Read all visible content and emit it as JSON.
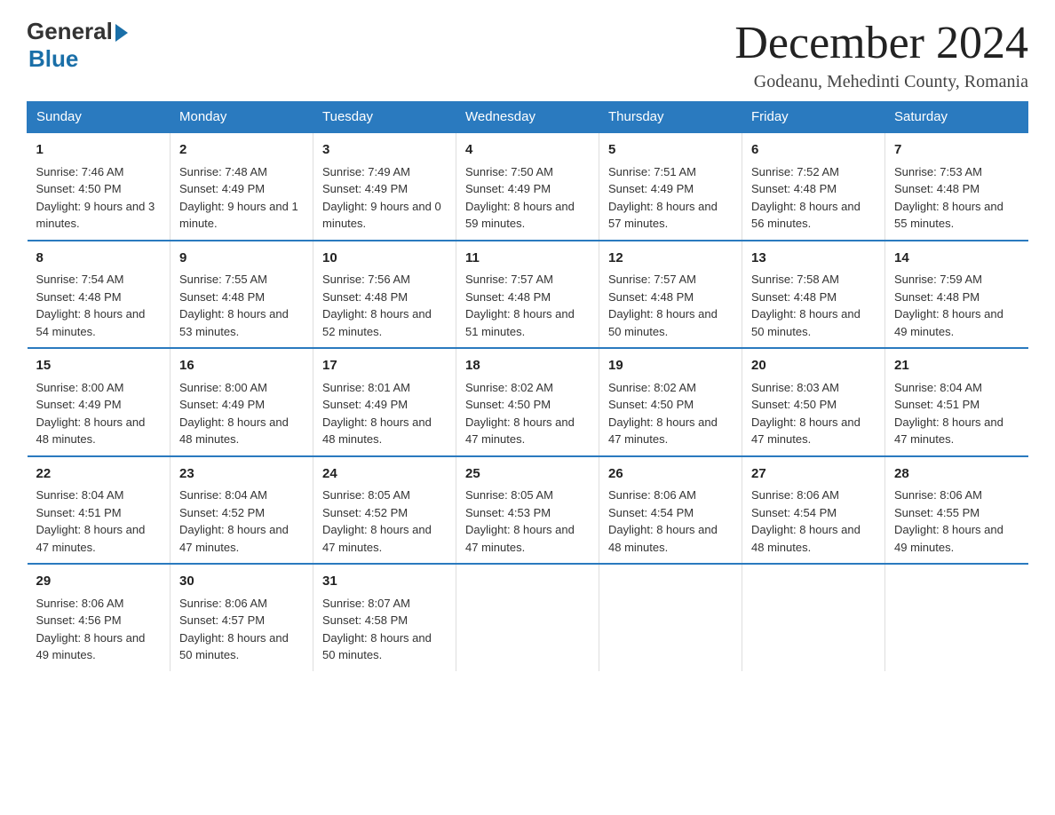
{
  "header": {
    "logo_general": "General",
    "logo_blue": "Blue",
    "month_title": "December 2024",
    "location": "Godeanu, Mehedinti County, Romania"
  },
  "days_of_week": [
    "Sunday",
    "Monday",
    "Tuesday",
    "Wednesday",
    "Thursday",
    "Friday",
    "Saturday"
  ],
  "weeks": [
    [
      {
        "day": "1",
        "sunrise": "7:46 AM",
        "sunset": "4:50 PM",
        "daylight": "9 hours and 3 minutes."
      },
      {
        "day": "2",
        "sunrise": "7:48 AM",
        "sunset": "4:49 PM",
        "daylight": "9 hours and 1 minute."
      },
      {
        "day": "3",
        "sunrise": "7:49 AM",
        "sunset": "4:49 PM",
        "daylight": "9 hours and 0 minutes."
      },
      {
        "day": "4",
        "sunrise": "7:50 AM",
        "sunset": "4:49 PM",
        "daylight": "8 hours and 59 minutes."
      },
      {
        "day": "5",
        "sunrise": "7:51 AM",
        "sunset": "4:49 PM",
        "daylight": "8 hours and 57 minutes."
      },
      {
        "day": "6",
        "sunrise": "7:52 AM",
        "sunset": "4:48 PM",
        "daylight": "8 hours and 56 minutes."
      },
      {
        "day": "7",
        "sunrise": "7:53 AM",
        "sunset": "4:48 PM",
        "daylight": "8 hours and 55 minutes."
      }
    ],
    [
      {
        "day": "8",
        "sunrise": "7:54 AM",
        "sunset": "4:48 PM",
        "daylight": "8 hours and 54 minutes."
      },
      {
        "day": "9",
        "sunrise": "7:55 AM",
        "sunset": "4:48 PM",
        "daylight": "8 hours and 53 minutes."
      },
      {
        "day": "10",
        "sunrise": "7:56 AM",
        "sunset": "4:48 PM",
        "daylight": "8 hours and 52 minutes."
      },
      {
        "day": "11",
        "sunrise": "7:57 AM",
        "sunset": "4:48 PM",
        "daylight": "8 hours and 51 minutes."
      },
      {
        "day": "12",
        "sunrise": "7:57 AM",
        "sunset": "4:48 PM",
        "daylight": "8 hours and 50 minutes."
      },
      {
        "day": "13",
        "sunrise": "7:58 AM",
        "sunset": "4:48 PM",
        "daylight": "8 hours and 50 minutes."
      },
      {
        "day": "14",
        "sunrise": "7:59 AM",
        "sunset": "4:48 PM",
        "daylight": "8 hours and 49 minutes."
      }
    ],
    [
      {
        "day": "15",
        "sunrise": "8:00 AM",
        "sunset": "4:49 PM",
        "daylight": "8 hours and 48 minutes."
      },
      {
        "day": "16",
        "sunrise": "8:00 AM",
        "sunset": "4:49 PM",
        "daylight": "8 hours and 48 minutes."
      },
      {
        "day": "17",
        "sunrise": "8:01 AM",
        "sunset": "4:49 PM",
        "daylight": "8 hours and 48 minutes."
      },
      {
        "day": "18",
        "sunrise": "8:02 AM",
        "sunset": "4:50 PM",
        "daylight": "8 hours and 47 minutes."
      },
      {
        "day": "19",
        "sunrise": "8:02 AM",
        "sunset": "4:50 PM",
        "daylight": "8 hours and 47 minutes."
      },
      {
        "day": "20",
        "sunrise": "8:03 AM",
        "sunset": "4:50 PM",
        "daylight": "8 hours and 47 minutes."
      },
      {
        "day": "21",
        "sunrise": "8:04 AM",
        "sunset": "4:51 PM",
        "daylight": "8 hours and 47 minutes."
      }
    ],
    [
      {
        "day": "22",
        "sunrise": "8:04 AM",
        "sunset": "4:51 PM",
        "daylight": "8 hours and 47 minutes."
      },
      {
        "day": "23",
        "sunrise": "8:04 AM",
        "sunset": "4:52 PM",
        "daylight": "8 hours and 47 minutes."
      },
      {
        "day": "24",
        "sunrise": "8:05 AM",
        "sunset": "4:52 PM",
        "daylight": "8 hours and 47 minutes."
      },
      {
        "day": "25",
        "sunrise": "8:05 AM",
        "sunset": "4:53 PM",
        "daylight": "8 hours and 47 minutes."
      },
      {
        "day": "26",
        "sunrise": "8:06 AM",
        "sunset": "4:54 PM",
        "daylight": "8 hours and 48 minutes."
      },
      {
        "day": "27",
        "sunrise": "8:06 AM",
        "sunset": "4:54 PM",
        "daylight": "8 hours and 48 minutes."
      },
      {
        "day": "28",
        "sunrise": "8:06 AM",
        "sunset": "4:55 PM",
        "daylight": "8 hours and 49 minutes."
      }
    ],
    [
      {
        "day": "29",
        "sunrise": "8:06 AM",
        "sunset": "4:56 PM",
        "daylight": "8 hours and 49 minutes."
      },
      {
        "day": "30",
        "sunrise": "8:06 AM",
        "sunset": "4:57 PM",
        "daylight": "8 hours and 50 minutes."
      },
      {
        "day": "31",
        "sunrise": "8:07 AM",
        "sunset": "4:58 PM",
        "daylight": "8 hours and 50 minutes."
      },
      null,
      null,
      null,
      null
    ]
  ]
}
